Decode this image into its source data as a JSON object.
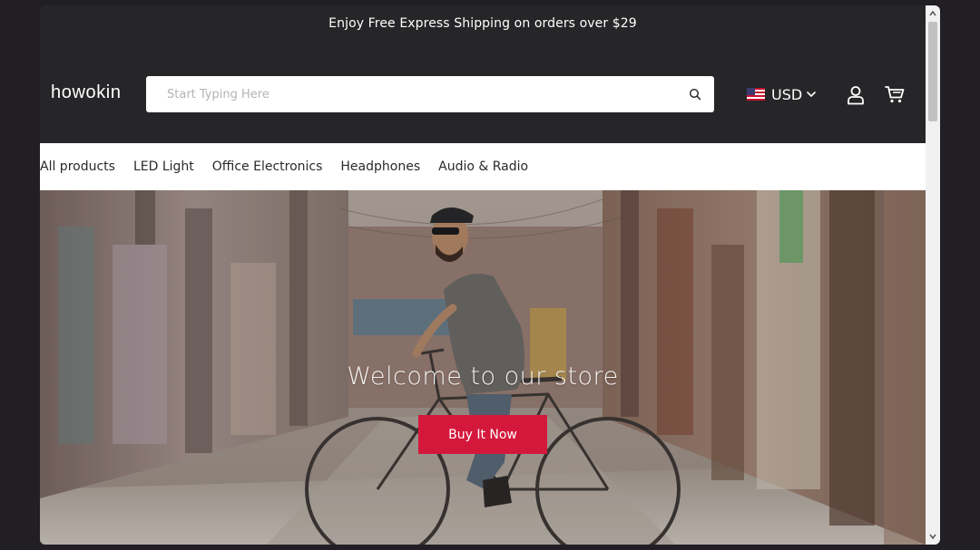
{
  "announcement": "Enjoy Free Express Shipping on orders over $29",
  "logo": "howokin",
  "search": {
    "placeholder": "Start Typing Here",
    "icon": "search-icon"
  },
  "currency": {
    "code": "USD",
    "flag": "us-flag-icon"
  },
  "header_icons": [
    "account-icon",
    "cart-icon"
  ],
  "nav": {
    "items": [
      {
        "label": "All products"
      },
      {
        "label": "LED Light"
      },
      {
        "label": "Office Electronics"
      },
      {
        "label": "Headphones"
      },
      {
        "label": "Audio & Radio"
      }
    ]
  },
  "hero": {
    "title": "Welcome to our store",
    "button": "Buy It Now"
  },
  "colors": {
    "header_bg": "#262628",
    "button_red": "#d4183c",
    "nav_bg": "#ffffff"
  }
}
